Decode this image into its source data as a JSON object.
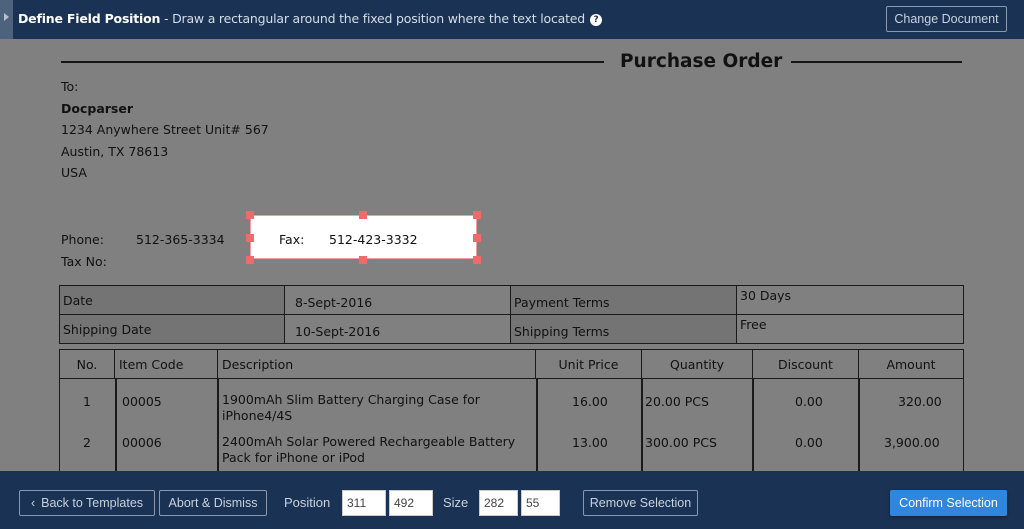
{
  "header": {
    "title": "Define Field Position",
    "separator": " - ",
    "description": "Draw a rectangular around the fixed position where the text located",
    "help_icon": "?",
    "change_document_label": "Change Document"
  },
  "document": {
    "title": "Purchase Order",
    "to_label": "To:",
    "company": "Docparser",
    "address_line1": "1234 Anywhere Street Unit# 567",
    "address_line2": "Austin, TX 78613",
    "country": "USA",
    "phone_label": "Phone:",
    "phone_value": "512-365-3334",
    "fax_label": "Fax:",
    "fax_value": "512-423-3332",
    "taxno_label": "Tax No:",
    "info_table": [
      {
        "label1": "Date",
        "value1": "8-Sept-2016",
        "label2": "Payment Terms",
        "value2": "30 Days"
      },
      {
        "label1": "Shipping Date",
        "value1": "10-Sept-2016",
        "label2": "Shipping Terms",
        "value2": "Free"
      }
    ],
    "items_headers": [
      "No.",
      "Item Code",
      "Description",
      "Unit Price",
      "Quantity",
      "Discount",
      "Amount"
    ],
    "items": [
      {
        "no": "1",
        "code": "00005",
        "desc1": "1900mAh Slim Battery Charging Case for",
        "desc2": "iPhone4/4S",
        "price": "16.00",
        "qty": "20.00 PCS",
        "discount": "0.00",
        "amount": "320.00"
      },
      {
        "no": "2",
        "code": "00006",
        "desc1": "2400mAh Solar Powered Rechargeable Battery",
        "desc2": "Pack for iPhone or iPod",
        "price": "13.00",
        "qty": "300.00 PCS",
        "discount": "0.00",
        "amount": "3,900.00"
      }
    ]
  },
  "footer": {
    "back_label": "Back to Templates",
    "back_icon": "‹",
    "abort_label": "Abort & Dismiss",
    "position_label": "Position",
    "position_x": "311",
    "position_y": "492",
    "size_label": "Size",
    "size_w": "282",
    "size_h": "55",
    "remove_label": "Remove Selection",
    "confirm_label": "Confirm Selection"
  }
}
